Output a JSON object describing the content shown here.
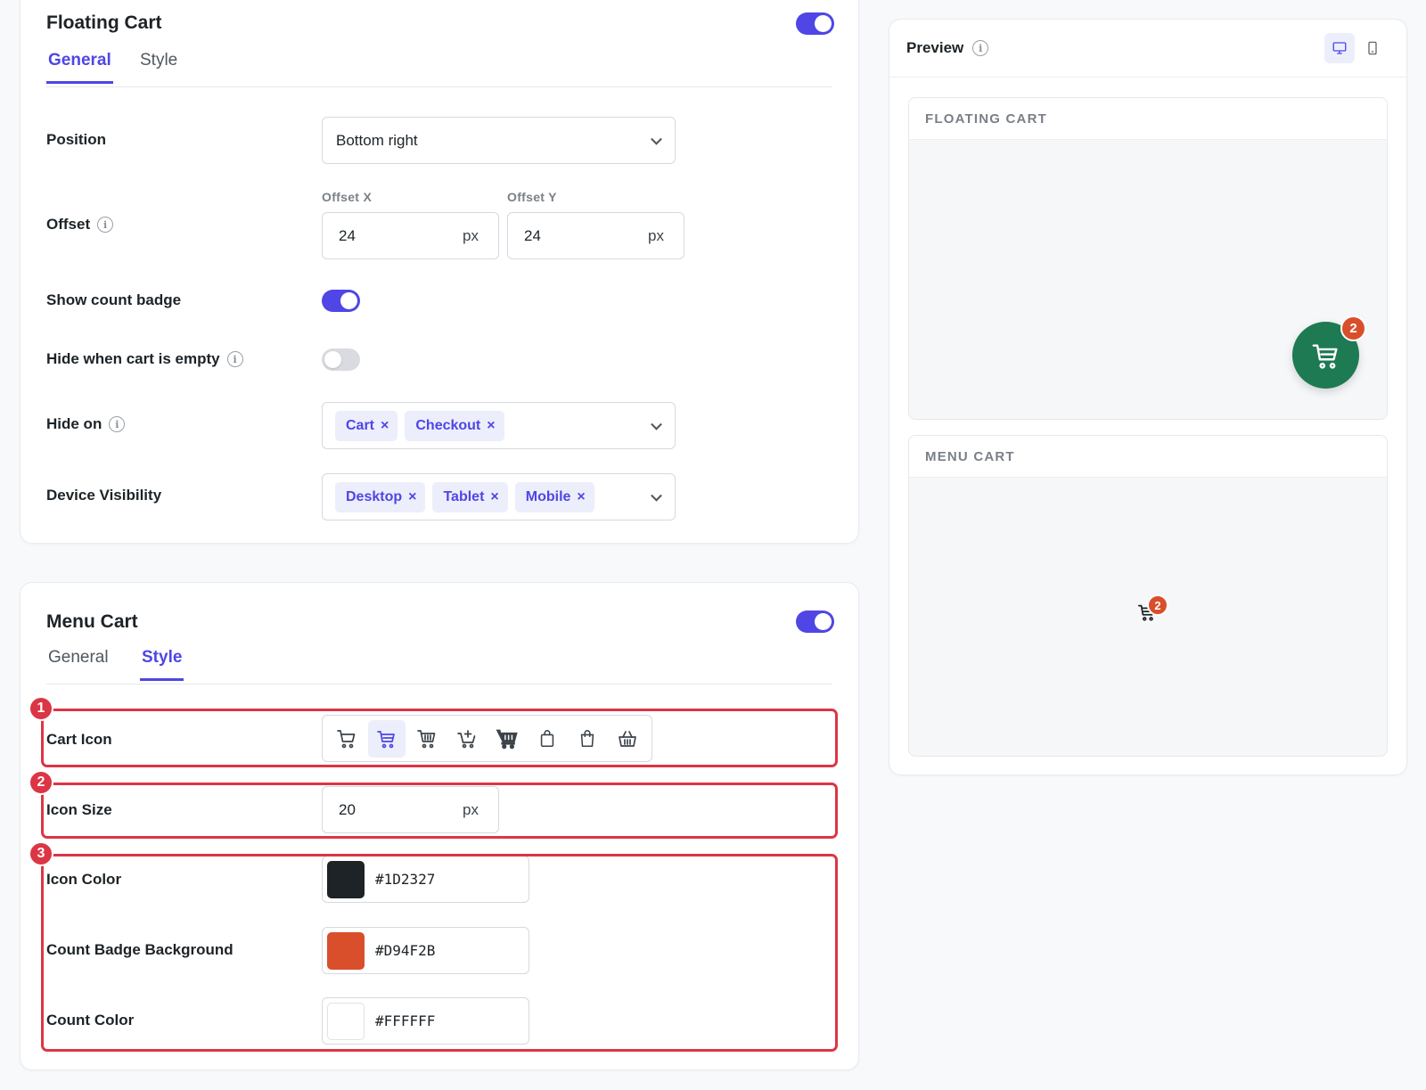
{
  "floating_cart": {
    "title": "Floating Cart",
    "enabled": true,
    "tabs": [
      {
        "label": "General",
        "active": true
      },
      {
        "label": "Style",
        "active": false
      }
    ],
    "position": {
      "label": "Position",
      "value": "Bottom right"
    },
    "offset": {
      "label": "Offset",
      "x_label": "Offset X",
      "x_value": "24",
      "y_label": "Offset Y",
      "y_value": "24",
      "unit": "px"
    },
    "show_count_badge": {
      "label": "Show count badge",
      "on": true
    },
    "hide_when_empty": {
      "label": "Hide when cart is empty",
      "on": false
    },
    "hide_on": {
      "label": "Hide on",
      "chips": [
        "Cart",
        "Checkout"
      ]
    },
    "device_visibility": {
      "label": "Device Visibility",
      "chips": [
        "Desktop",
        "Tablet",
        "Mobile"
      ]
    }
  },
  "menu_cart": {
    "title": "Menu Cart",
    "enabled": true,
    "tabs": [
      {
        "label": "General",
        "active": false
      },
      {
        "label": "Style",
        "active": true
      }
    ],
    "cart_icon": {
      "label": "Cart Icon",
      "icons": [
        "cart-icon",
        "cart-outline-icon",
        "cart-lines-icon",
        "cart-plus-icon",
        "cart-filled-icon",
        "bag-icon",
        "bag-handle-icon",
        "basket-icon"
      ],
      "selected_index": 1
    },
    "icon_size": {
      "label": "Icon Size",
      "value": "20",
      "unit": "px"
    },
    "icon_color": {
      "label": "Icon Color",
      "hex": "#1D2327"
    },
    "count_badge_bg": {
      "label": "Count Badge Background",
      "hex": "#D94F2B"
    },
    "count_color": {
      "label": "Count Color",
      "hex": "#FFFFFF"
    }
  },
  "highlights": [
    "1",
    "2",
    "3"
  ],
  "preview": {
    "title": "Preview",
    "devices": [
      "desktop-icon",
      "mobile-icon"
    ],
    "floating_section": "FLOATING CART",
    "menu_section": "MENU CART",
    "floating_count": "2",
    "menu_count": "2",
    "fab_color": "#1E7A52"
  }
}
